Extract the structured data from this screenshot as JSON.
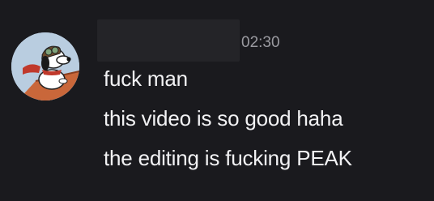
{
  "message": {
    "timestamp": "02:30",
    "lines": [
      "fuck man",
      "this video is so good haha",
      "the editing is fucking PEAK"
    ]
  },
  "avatar": {
    "icon": "snoopy-flying-ace-avatar",
    "colors": {
      "sky": "#b9cde0",
      "scarf": "#c0392b",
      "dog": "#ffffff",
      "doghouse": "#c9673a"
    }
  },
  "theme": {
    "background": "#1a1a1e",
    "text": "#f2f2f4",
    "muted": "#9a9aa0",
    "redaction": "#242428"
  }
}
